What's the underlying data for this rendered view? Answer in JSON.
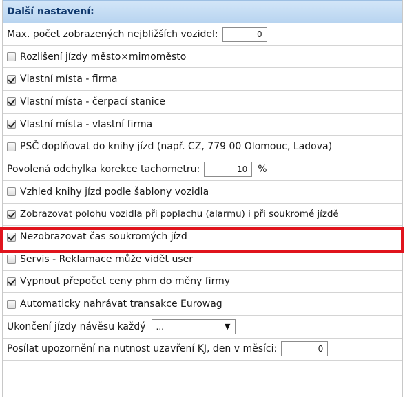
{
  "header": {
    "title": "Další nastavení:"
  },
  "rows": {
    "max_vehicles": {
      "label": "Max. počet zobrazených nejbližších vozidel:",
      "value": "0"
    },
    "city_split": {
      "label": "Rozlišení jízdy město×mimoměsto",
      "checked": false
    },
    "own_places_company": {
      "label": "Vlastní místa - firma",
      "checked": true
    },
    "own_places_station": {
      "label": "Vlastní místa - čerpací stanice",
      "checked": true
    },
    "own_places_own_company": {
      "label": "Vlastní místa - vlastní firma",
      "checked": true
    },
    "psc": {
      "label": "PSČ doplňovat do knihy jízd (např. CZ, 779 00 Olomouc, Ladova)",
      "checked": false
    },
    "tacho": {
      "label": "Povolená odchylka korekce tachometru:",
      "value": "10",
      "unit": "%"
    },
    "template_look": {
      "label": "Vzhled knihy jízd podle šablony vozidla",
      "checked": false
    },
    "alarm_position": {
      "label": "Zobrazovat polohu vozidla při poplachu (alarmu) i při soukromé jízdě",
      "checked": true
    },
    "hide_private_time": {
      "label": "Nezobrazovat čas soukromých jízd",
      "checked": true
    },
    "service_claims": {
      "label": "Servis - Reklamace může vidět user",
      "checked": false
    },
    "fuel_conversion": {
      "label": "Vypnout přepočet ceny phm do měny firmy",
      "checked": true
    },
    "eurowag": {
      "label": "Automaticky nahrávat transakce Eurowag",
      "checked": false
    },
    "trailer_end": {
      "label": "Ukončení jízdy návěsu každý",
      "selected": "..."
    },
    "notify": {
      "label": "Posílat upozornění na nutnost uzavření KJ, den v měsíci:",
      "value": "0"
    }
  }
}
